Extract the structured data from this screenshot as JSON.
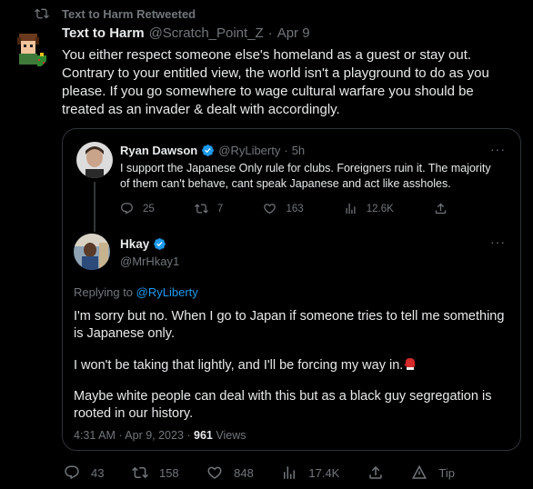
{
  "retweet": {
    "label": "Text to Harm Retweeted"
  },
  "main_tweet": {
    "name": "Text to Harm",
    "handle": "@Scratch_Point_Z",
    "separator": "·",
    "date": "Apr 9",
    "body": "You either respect someone else's homeland as a guest or stay out. Contrary to your entitled view, the world isn't a playground to do as you please. If you go somewhere to wage cultural warfare you should be treated as an invader & dealt with accordingly."
  },
  "quoted_parent": {
    "name": "Ryan Dawson",
    "handle": "@RyLiberty",
    "separator": "·",
    "time": "5h",
    "more": "···",
    "body": "I support the Japanese Only rule for clubs. Foreigners ruin it. The majority of them can't behave, cant speak Japanese and act like assholes.",
    "actions": {
      "replies": "25",
      "retweets": "7",
      "likes": "163",
      "views": "12.6K"
    }
  },
  "quoted_reply": {
    "name": "Hkay",
    "handle": "@MrHkay1",
    "more": "···",
    "replying_prefix": "Replying to",
    "replying_to": "@RyLiberty",
    "paragraph1": "I'm sorry but no. When I go to Japan if someone tries to tell me something is Japanese only.",
    "paragraph2": "I won't be taking that lightly, and I'll be forcing my way in.",
    "paragraph3": "Maybe white people can deal with this but as a black guy segregation is rooted in our history.",
    "timestamp": "4:31 AM · Apr 9, 2023 ·",
    "views_count": "961",
    "views_label": "Views"
  },
  "bottom_actions": {
    "replies": "43",
    "retweets": "158",
    "likes": "848",
    "views": "17.4K",
    "tip": "Tip"
  },
  "colors": {
    "background": "#000000",
    "accent": "#1d9bf0",
    "muted": "#71767b",
    "border": "#2f3336"
  }
}
